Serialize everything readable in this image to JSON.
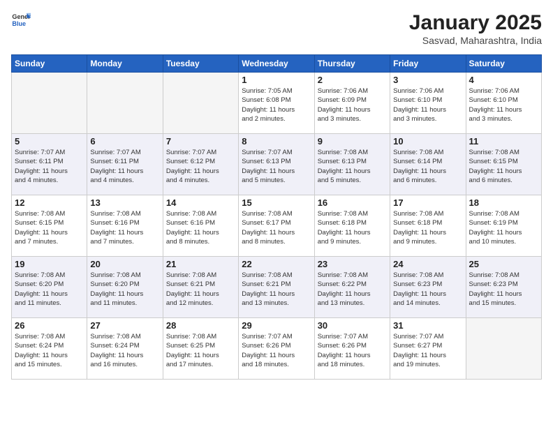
{
  "header": {
    "logo_general": "General",
    "logo_blue": "Blue",
    "month_year": "January 2025",
    "location": "Sasvad, Maharashtra, India"
  },
  "days_of_week": [
    "Sunday",
    "Monday",
    "Tuesday",
    "Wednesday",
    "Thursday",
    "Friday",
    "Saturday"
  ],
  "weeks": [
    [
      {
        "day": "",
        "info": ""
      },
      {
        "day": "",
        "info": ""
      },
      {
        "day": "",
        "info": ""
      },
      {
        "day": "1",
        "info": "Sunrise: 7:05 AM\nSunset: 6:08 PM\nDaylight: 11 hours\nand 2 minutes."
      },
      {
        "day": "2",
        "info": "Sunrise: 7:06 AM\nSunset: 6:09 PM\nDaylight: 11 hours\nand 3 minutes."
      },
      {
        "day": "3",
        "info": "Sunrise: 7:06 AM\nSunset: 6:10 PM\nDaylight: 11 hours\nand 3 minutes."
      },
      {
        "day": "4",
        "info": "Sunrise: 7:06 AM\nSunset: 6:10 PM\nDaylight: 11 hours\nand 3 minutes."
      }
    ],
    [
      {
        "day": "5",
        "info": "Sunrise: 7:07 AM\nSunset: 6:11 PM\nDaylight: 11 hours\nand 4 minutes."
      },
      {
        "day": "6",
        "info": "Sunrise: 7:07 AM\nSunset: 6:11 PM\nDaylight: 11 hours\nand 4 minutes."
      },
      {
        "day": "7",
        "info": "Sunrise: 7:07 AM\nSunset: 6:12 PM\nDaylight: 11 hours\nand 4 minutes."
      },
      {
        "day": "8",
        "info": "Sunrise: 7:07 AM\nSunset: 6:13 PM\nDaylight: 11 hours\nand 5 minutes."
      },
      {
        "day": "9",
        "info": "Sunrise: 7:08 AM\nSunset: 6:13 PM\nDaylight: 11 hours\nand 5 minutes."
      },
      {
        "day": "10",
        "info": "Sunrise: 7:08 AM\nSunset: 6:14 PM\nDaylight: 11 hours\nand 6 minutes."
      },
      {
        "day": "11",
        "info": "Sunrise: 7:08 AM\nSunset: 6:15 PM\nDaylight: 11 hours\nand 6 minutes."
      }
    ],
    [
      {
        "day": "12",
        "info": "Sunrise: 7:08 AM\nSunset: 6:15 PM\nDaylight: 11 hours\nand 7 minutes."
      },
      {
        "day": "13",
        "info": "Sunrise: 7:08 AM\nSunset: 6:16 PM\nDaylight: 11 hours\nand 7 minutes."
      },
      {
        "day": "14",
        "info": "Sunrise: 7:08 AM\nSunset: 6:16 PM\nDaylight: 11 hours\nand 8 minutes."
      },
      {
        "day": "15",
        "info": "Sunrise: 7:08 AM\nSunset: 6:17 PM\nDaylight: 11 hours\nand 8 minutes."
      },
      {
        "day": "16",
        "info": "Sunrise: 7:08 AM\nSunset: 6:18 PM\nDaylight: 11 hours\nand 9 minutes."
      },
      {
        "day": "17",
        "info": "Sunrise: 7:08 AM\nSunset: 6:18 PM\nDaylight: 11 hours\nand 9 minutes."
      },
      {
        "day": "18",
        "info": "Sunrise: 7:08 AM\nSunset: 6:19 PM\nDaylight: 11 hours\nand 10 minutes."
      }
    ],
    [
      {
        "day": "19",
        "info": "Sunrise: 7:08 AM\nSunset: 6:20 PM\nDaylight: 11 hours\nand 11 minutes."
      },
      {
        "day": "20",
        "info": "Sunrise: 7:08 AM\nSunset: 6:20 PM\nDaylight: 11 hours\nand 11 minutes."
      },
      {
        "day": "21",
        "info": "Sunrise: 7:08 AM\nSunset: 6:21 PM\nDaylight: 11 hours\nand 12 minutes."
      },
      {
        "day": "22",
        "info": "Sunrise: 7:08 AM\nSunset: 6:21 PM\nDaylight: 11 hours\nand 13 minutes."
      },
      {
        "day": "23",
        "info": "Sunrise: 7:08 AM\nSunset: 6:22 PM\nDaylight: 11 hours\nand 13 minutes."
      },
      {
        "day": "24",
        "info": "Sunrise: 7:08 AM\nSunset: 6:23 PM\nDaylight: 11 hours\nand 14 minutes."
      },
      {
        "day": "25",
        "info": "Sunrise: 7:08 AM\nSunset: 6:23 PM\nDaylight: 11 hours\nand 15 minutes."
      }
    ],
    [
      {
        "day": "26",
        "info": "Sunrise: 7:08 AM\nSunset: 6:24 PM\nDaylight: 11 hours\nand 15 minutes."
      },
      {
        "day": "27",
        "info": "Sunrise: 7:08 AM\nSunset: 6:24 PM\nDaylight: 11 hours\nand 16 minutes."
      },
      {
        "day": "28",
        "info": "Sunrise: 7:08 AM\nSunset: 6:25 PM\nDaylight: 11 hours\nand 17 minutes."
      },
      {
        "day": "29",
        "info": "Sunrise: 7:07 AM\nSunset: 6:26 PM\nDaylight: 11 hours\nand 18 minutes."
      },
      {
        "day": "30",
        "info": "Sunrise: 7:07 AM\nSunset: 6:26 PM\nDaylight: 11 hours\nand 18 minutes."
      },
      {
        "day": "31",
        "info": "Sunrise: 7:07 AM\nSunset: 6:27 PM\nDaylight: 11 hours\nand 19 minutes."
      },
      {
        "day": "",
        "info": ""
      }
    ]
  ]
}
